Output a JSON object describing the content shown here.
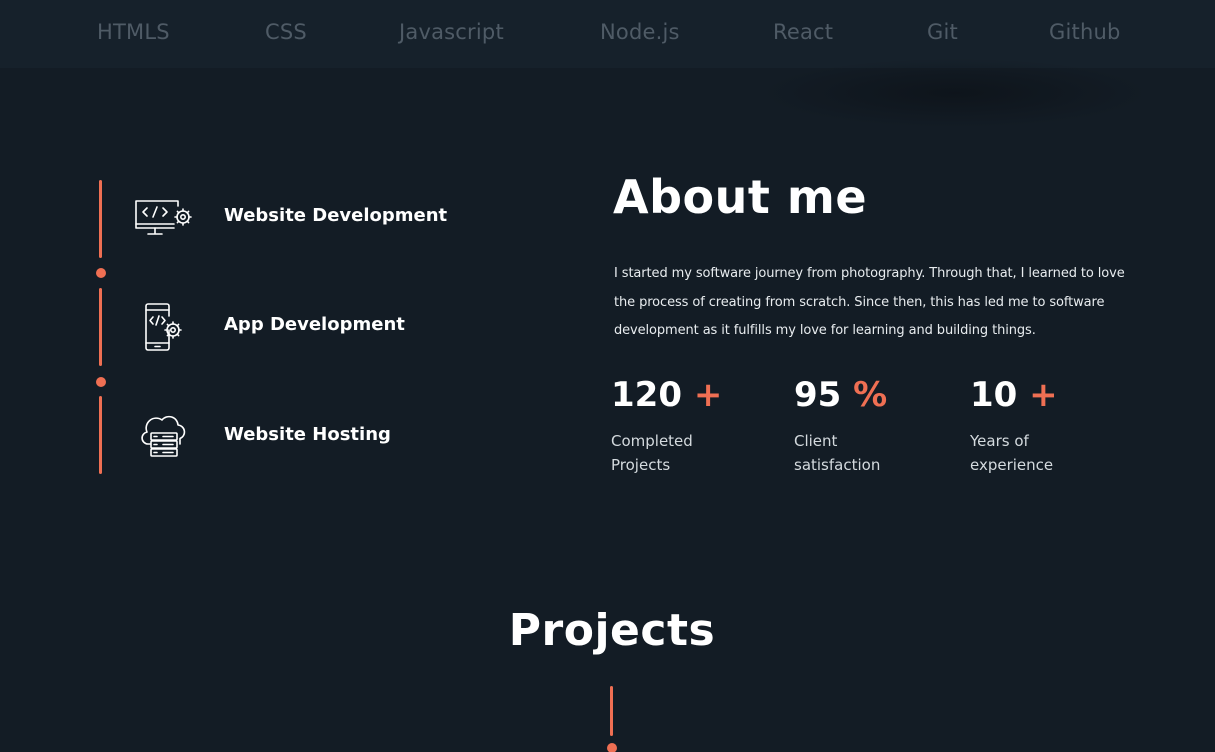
{
  "skills_bar": {
    "items": [
      "HTMLS",
      "CSS",
      "Javascript",
      "Node.js",
      "React",
      "Git",
      "Github"
    ]
  },
  "services": [
    {
      "label": "Website Development",
      "icon": "monitor-code-gear-icon"
    },
    {
      "label": "App Development",
      "icon": "phone-code-gear-icon"
    },
    {
      "label": "Website Hosting",
      "icon": "cloud-server-icon"
    }
  ],
  "about": {
    "title": "About me",
    "text": "I started my software journey from photography. Through that, I learned to love the process of creating from scratch. Since then, this has led me to software development as it fulfills my love for learning and building things.",
    "stats": [
      {
        "number": "120",
        "suffix": "+",
        "label_line1": "Completed",
        "label_line2": "Projects"
      },
      {
        "number": "95",
        "suffix": "%",
        "label_line1": "Client",
        "label_line2": "satisfaction"
      },
      {
        "number": "10",
        "suffix": "+",
        "label_line1": "Years of",
        "label_line2": "experience"
      }
    ]
  },
  "projects": {
    "title": "Projects"
  },
  "colors": {
    "background": "#131c25",
    "nav_background": "#16212b",
    "accent": "#ef6f53",
    "nav_text": "#4f5b66"
  }
}
